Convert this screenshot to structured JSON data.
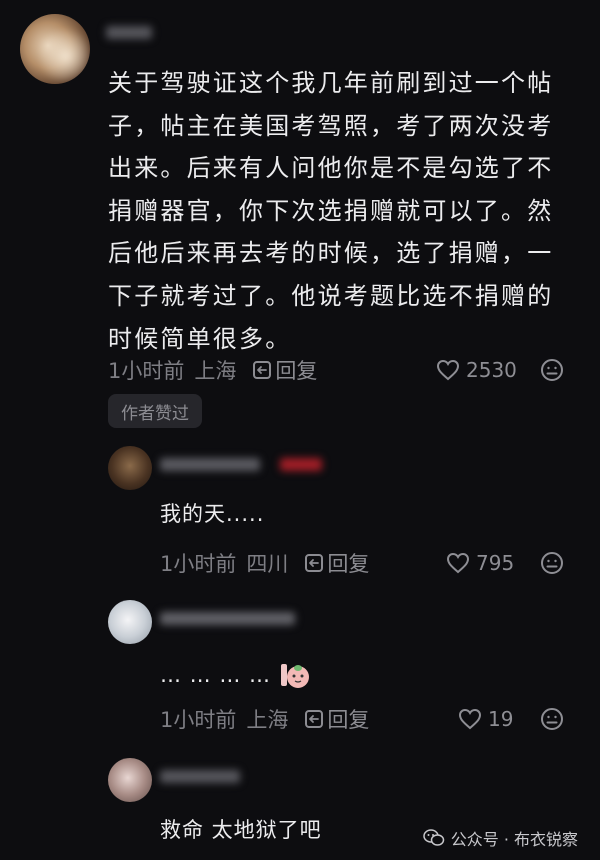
{
  "main_comment": {
    "text": "关于驾驶证这个我几年前刷到过一个帖子，帖主在美国考驾照，考了两次没考出来。后来有人问他你是不是勾选了不捐赠器官，你下次选捐赠就可以了。然后他后来再去考的时候，选了捐赠，一下子就考过了。他说考题比选不捐赠的时候简单很多。",
    "time": "1小时前",
    "location": "上海",
    "reply_label": "回复",
    "likes": "2530",
    "author_badge": "作者赞过"
  },
  "replies": [
    {
      "text": "我的天.....",
      "time": "1小时前",
      "location": "四川",
      "reply_label": "回复",
      "likes": "795"
    },
    {
      "text": "… … … …",
      "time": "1小时前",
      "location": "上海",
      "reply_label": "回复",
      "likes": "19"
    },
    {
      "text": "救命 太地狱了吧"
    }
  ],
  "watermark": {
    "text": "公众号 · 布衣锐察"
  },
  "colors": {
    "background": "#0d0d10",
    "text": "#ececee",
    "meta": "#7e7e84",
    "badge_bg": "#26262b"
  },
  "icons": [
    "heart-outline-icon",
    "dislike-face-icon",
    "reply-icon",
    "wechat-icon"
  ]
}
